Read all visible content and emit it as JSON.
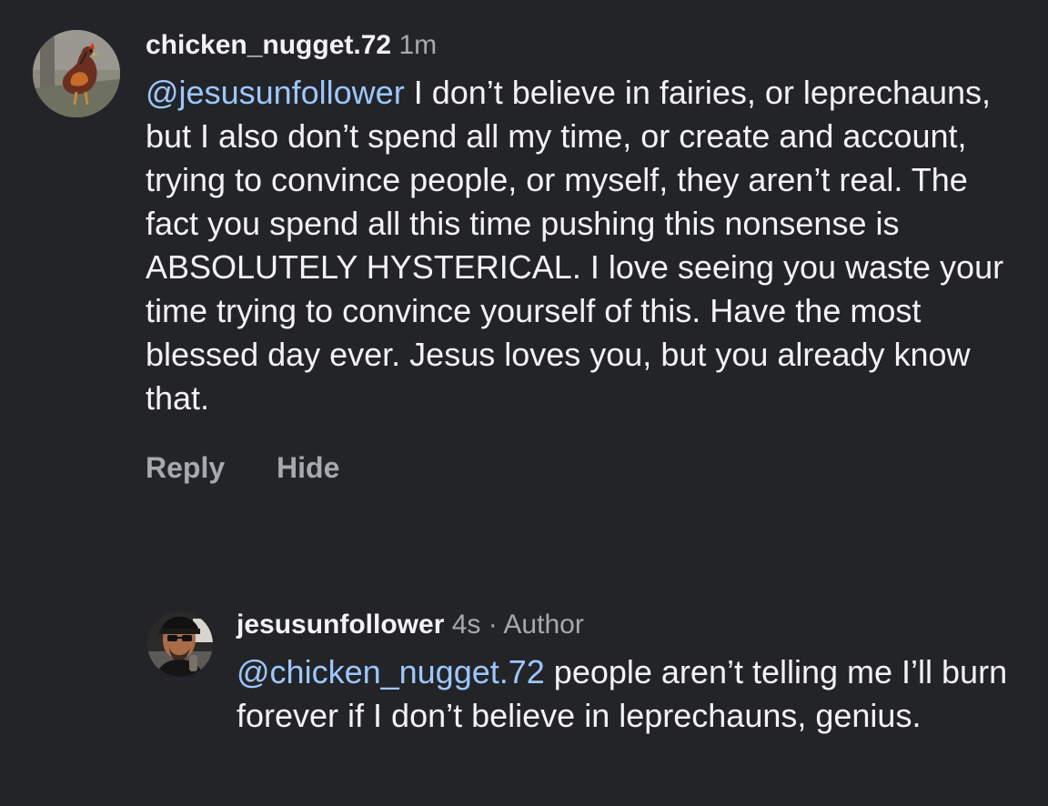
{
  "comments": [
    {
      "username": "chicken_nugget.72",
      "time": "1m",
      "mention": "@jesusunfollower",
      "text": " I don’t believe in fairies, or leprechauns, but I also don’t spend all my time, or create and account, trying to convince people, or myself, they aren’t real. The fact you spend all this time pushing this nonsense is ABSOLUTELY HYSTERICAL. I love seeing you waste your time trying to convince yourself of this. Have the most blessed day ever. Jesus loves you, but you already know that.",
      "actions": {
        "reply": "Reply",
        "hide": "Hide"
      }
    },
    {
      "username": "jesusunfollower",
      "time": "4s",
      "separator": " · ",
      "author_label": "Author",
      "mention": "@chicken_nugget.72",
      "text": " people aren’t telling me I’ll burn forever if I don’t believe in leprechauns, genius."
    }
  ],
  "colors": {
    "background": "#232428",
    "text": "#f3f3f5",
    "muted": "#a8a9ae",
    "mention": "#9dc7ff"
  },
  "icons": {
    "avatar_1": "rooster-avatar",
    "avatar_2": "person-avatar"
  }
}
